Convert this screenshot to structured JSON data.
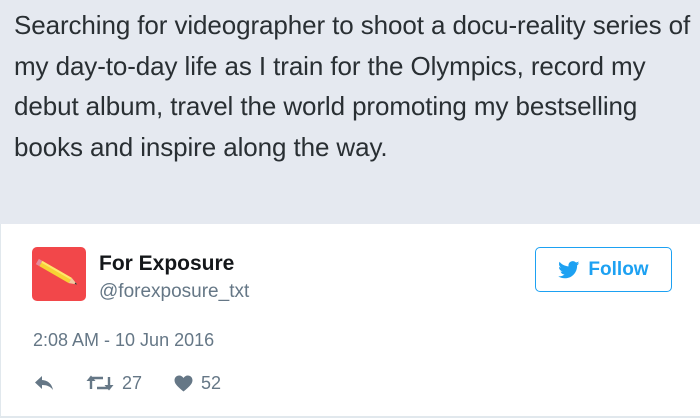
{
  "quote": {
    "text": "Searching for videographer to shoot a docu-reality series of my day-to-day life as I train for the Olympics, record my debut album, travel the world promoting my bestselling books and inspire along the way."
  },
  "user": {
    "display_name": "For Exposure",
    "handle": "@forexposure_txt",
    "avatar_icon": "pencil-icon",
    "avatar_color": "#f2474a"
  },
  "follow": {
    "label": "Follow",
    "icon": "bird-icon",
    "color": "#1da1f2"
  },
  "tweet": {
    "timestamp": "2:08 AM - 10 Jun 2016"
  },
  "actions": {
    "reply_icon": "reply-icon",
    "retweet_icon": "retweet-icon",
    "retweet_count": "27",
    "like_icon": "heart-icon",
    "like_count": "52"
  }
}
